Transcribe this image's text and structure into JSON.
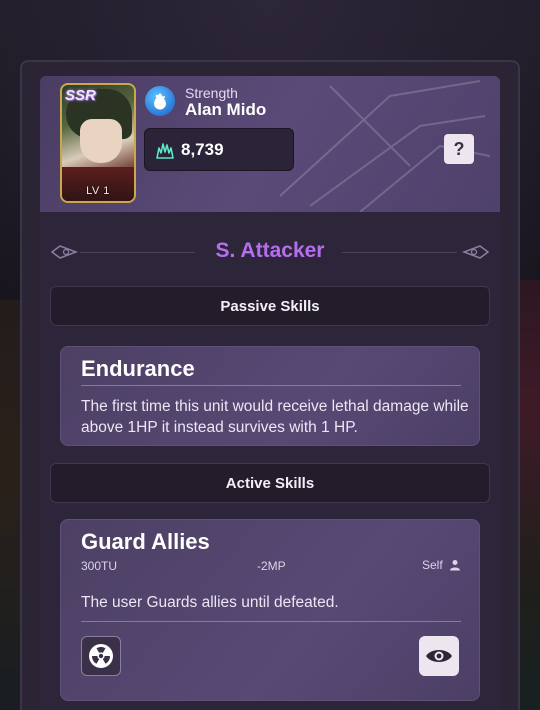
{
  "unit": {
    "rarity": "SSR",
    "level": "LV 1",
    "type_label": "Strength",
    "name": "Alan Mido",
    "power": "8,739",
    "element_icon": "water-drop-icon",
    "help_label": "?"
  },
  "role": {
    "title": "S. Attacker"
  },
  "sections": {
    "passive_label": "Passive Skills",
    "active_label": "Active Skills"
  },
  "passive_skill": {
    "name": "Endurance",
    "description": "The first time this unit would receive lethal damage while above 1HP it instead survives with 1 HP."
  },
  "active_skill": {
    "name": "Guard Allies",
    "cost_tu": "300TU",
    "cost_mp": "-2MP",
    "target": "Self",
    "description": "The user Guards allies until defeated.",
    "left_icon": "radiation-icon",
    "right_icon": "eye-icon"
  },
  "colors": {
    "role_accent": "#b66ef0",
    "portrait_border": "#c9a94a",
    "element": "#2b7ad9"
  }
}
